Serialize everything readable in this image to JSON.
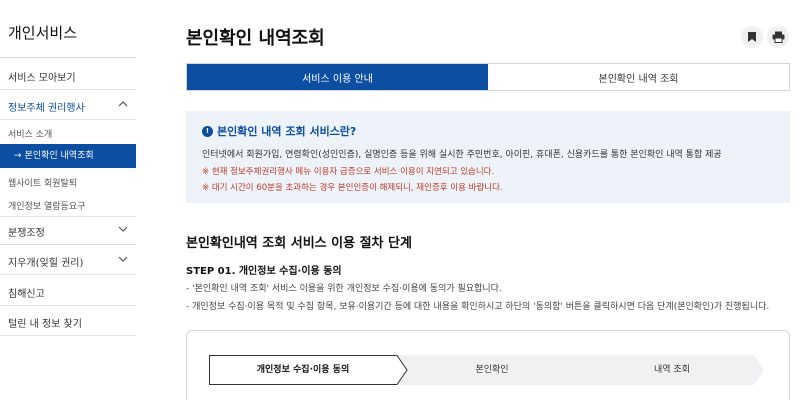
{
  "sidebar": {
    "title": "개인서비스",
    "items": [
      {
        "label": "서비스 모아보기"
      },
      {
        "label": "정보주체 권리행사"
      },
      {
        "label": "분쟁조정"
      },
      {
        "label": "지우개(잊힐 권리)"
      },
      {
        "label": "침해신고"
      },
      {
        "label": "털린 내 정보 찾기"
      }
    ],
    "sub_items": [
      {
        "label": "서비스 소개"
      },
      {
        "label": "본인확인 내역조회"
      },
      {
        "label": "웹사이트 회원탈퇴"
      },
      {
        "label": "개인정보 열람등요구"
      }
    ]
  },
  "header": {
    "title": "본인확인 내역조회",
    "icons": [
      "bookmark-icon",
      "print-icon"
    ]
  },
  "tabs": [
    {
      "label": "서비스 이용 안내"
    },
    {
      "label": "본인확인 내역 조회"
    }
  ],
  "info": {
    "heading": "본인확인 내역 조회 서비스란?",
    "description": "인터넷에서 회원가입, 연령확인(성인인증), 실명인증 등을 위해 실시한 주민번호, 아이핀, 휴대폰, 신용카드를 통한 본인확인 내역 통합 제공",
    "notes": [
      "※ 현재 정보주체권리행사 메뉴 이용자 급증으로 서비스 이용이 지연되고 있습니다.",
      "※ 대기 시간이 60분을 초과하는 경우 본인인증이 해제되니, 재인증후 이용 바랍니다."
    ]
  },
  "section": {
    "title": "본인확인내역 조회 서비스 이용 절차 단계",
    "step_title": "STEP 01. 개인정보 수집·이용 동의",
    "lines": [
      "- '본인확인 내역 조회' 서비스 이용을 위한 개인정보 수집·이용에 동의가 필요합니다.",
      "- 개인정보 수집·이용 목적 및 수집 항목, 보유·이용기간 등에 대한 내용을 확인하시고 하단의 '동의함' 버튼을 클릭하시면 다음 단계(본인확인)가 진행됩니다."
    ]
  },
  "flow": {
    "steps": [
      {
        "label": "개인정보 수집·이용 동의"
      },
      {
        "label": "본인확인"
      },
      {
        "label": "내역 조회"
      }
    ]
  },
  "colors": {
    "accent": "#0b4ea2",
    "warning": "#c0392b",
    "info_bg": "#eef3fa"
  }
}
